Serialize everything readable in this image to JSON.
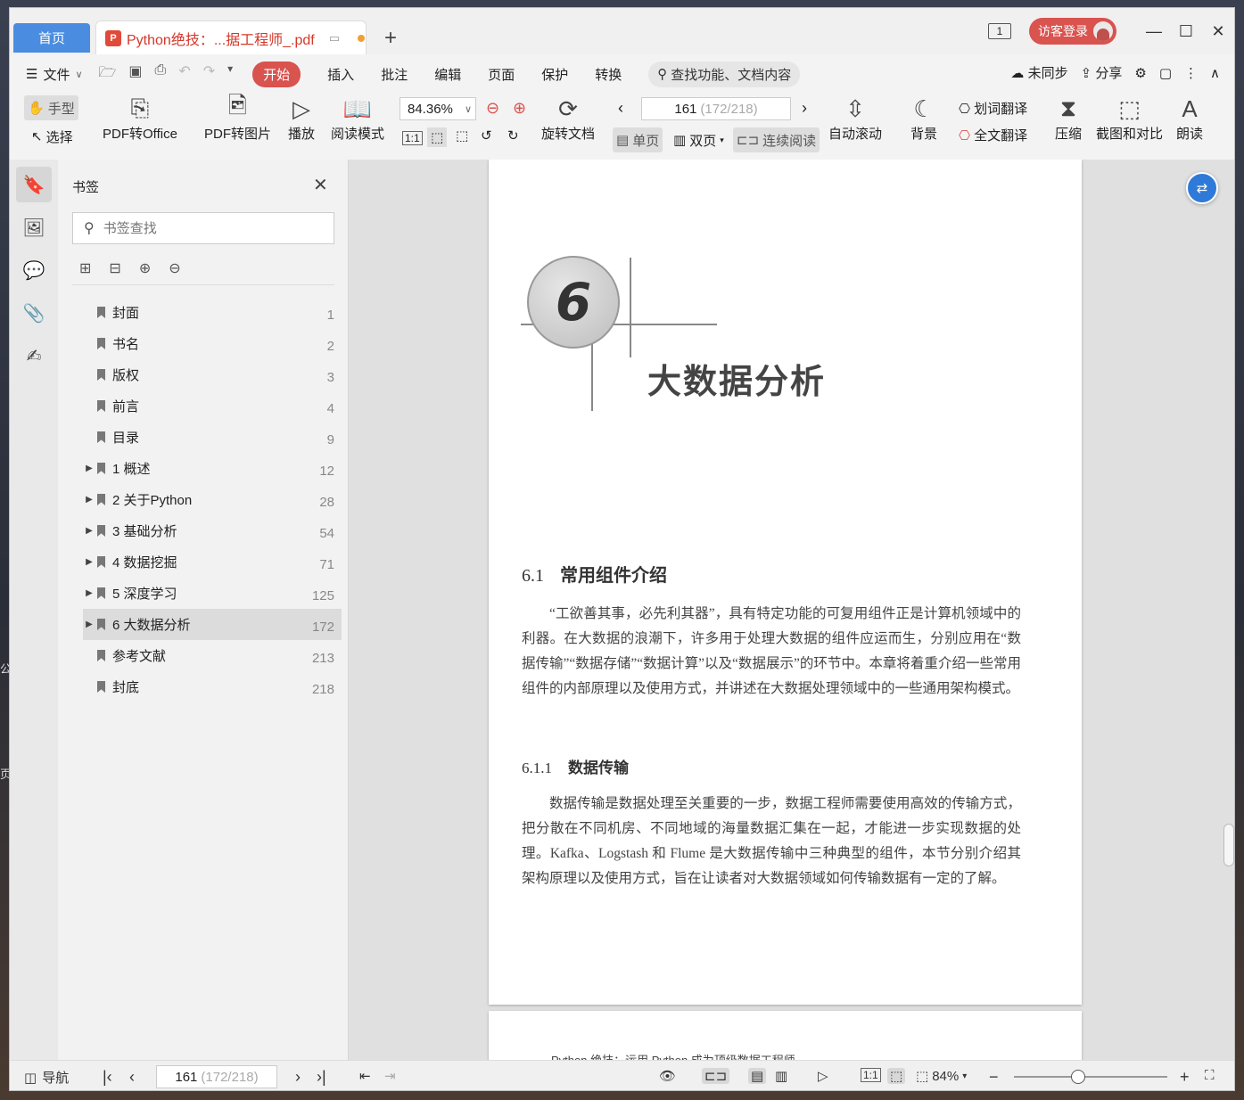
{
  "desktop": {
    "left_chars": [
      "公",
      "页"
    ]
  },
  "tabs": {
    "home": "首页",
    "doc": "Python绝技：...据工程师_.pdf"
  },
  "titlebar": {
    "login": "访客登录"
  },
  "menu": {
    "file": "文件",
    "tabs": [
      "开始",
      "插入",
      "批注",
      "编辑",
      "页面",
      "保护",
      "转换"
    ],
    "search": "查找功能、文档内容",
    "sync": "未同步",
    "share": "分享"
  },
  "ribbon": {
    "hand": "手型",
    "select": "选择",
    "pdf_office": "PDF转Office",
    "pdf_image": "PDF转图片",
    "play": "播放",
    "read_mode": "阅读模式",
    "zoom": "84.36%",
    "rotate": "旋转文档",
    "page": "161",
    "page_sub": "(172/218)",
    "single": "单页",
    "double": "双页",
    "continuous": "连续阅读",
    "auto_scroll": "自动滚动",
    "background": "背景",
    "word_translate": "划词翻译",
    "full_translate": "全文翻译",
    "compress": "压缩",
    "screenshot": "截图和对比",
    "read_aloud": "朗读"
  },
  "panel": {
    "title": "书签",
    "search_placeholder": "书签查找",
    "items": [
      {
        "label": "封面",
        "page": "1",
        "expandable": false
      },
      {
        "label": "书名",
        "page": "2",
        "expandable": false
      },
      {
        "label": "版权",
        "page": "3",
        "expandable": false
      },
      {
        "label": "前言",
        "page": "4",
        "expandable": false
      },
      {
        "label": "目录",
        "page": "9",
        "expandable": false
      },
      {
        "label": "1 概述",
        "page": "12",
        "expandable": true
      },
      {
        "label": "2 关于Python",
        "page": "28",
        "expandable": true
      },
      {
        "label": "3 基础分析",
        "page": "54",
        "expandable": true
      },
      {
        "label": "4 数据挖掘",
        "page": "71",
        "expandable": true
      },
      {
        "label": "5 深度学习",
        "page": "125",
        "expandable": true
      },
      {
        "label": "6 大数据分析",
        "page": "172",
        "expandable": true,
        "selected": true
      },
      {
        "label": "参考文献",
        "page": "213",
        "expandable": false
      },
      {
        "label": "封底",
        "page": "218",
        "expandable": false
      }
    ]
  },
  "document": {
    "chapter_number": "6",
    "chapter_title": "大数据分析",
    "section_num": "6.1",
    "section_title": "常用组件介绍",
    "para1": "“工欲善其事，必先利其器”，具有特定功能的可复用组件正是计算机领域中的利器。在大数据的浪潮下，许多用于处理大数据的组件应运而生，分别应用在“数据传输”“数据存储”“数据计算”以及“数据展示”的环节中。本章将着重介绍一些常用组件的内部原理以及使用方式，并讲述在大数据处理领域中的一些通用架构模式。",
    "subsection_num": "6.1.1",
    "subsection_title": "数据传输",
    "para2": "数据传输是数据处理至关重要的一步，数据工程师需要使用高效的传输方式，把分散在不同机房、不同地域的海量数据汇集在一起，才能进一步实现数据的处理。Kafka、Logstash 和 Flume 是大数据传输中三种典型的组件，本节分别介绍其架构原理以及使用方式，旨在让读者对大数据领域如何传输数据有一定的了解。",
    "next_page_header": "Python 绝技：运用 Python 成为顶级数据工程师"
  },
  "status": {
    "nav": "导航",
    "page": "161",
    "page_sub": "(172/218)",
    "zoom": "84%"
  },
  "colors": {
    "accent_red": "#d9534f",
    "home_tab": "#4a8de0",
    "float_btn": "#2f7ad8"
  }
}
